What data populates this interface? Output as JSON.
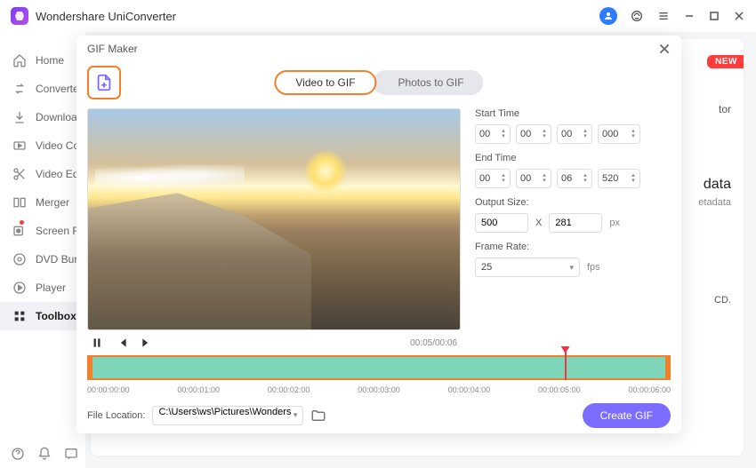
{
  "app": {
    "title": "Wondershare UniConverter"
  },
  "sidebar": {
    "items": [
      {
        "label": "Home"
      },
      {
        "label": "Converter"
      },
      {
        "label": "Downloader"
      },
      {
        "label": "Video Compressor"
      },
      {
        "label": "Video Editor"
      },
      {
        "label": "Merger"
      },
      {
        "label": "Screen Recorder"
      },
      {
        "label": "DVD Burner"
      },
      {
        "label": "Player"
      },
      {
        "label": "Toolbox"
      }
    ]
  },
  "bg": {
    "new_badge": "NEW",
    "text1": "tor",
    "text2": "data",
    "text3": "etadata",
    "text4": "CD."
  },
  "dialog": {
    "title": "GIF Maker",
    "tabs": {
      "video": "Video to GIF",
      "photos": "Photos to GIF"
    },
    "start_label": "Start Time",
    "end_label": "End Time",
    "start": {
      "h": "00",
      "m": "00",
      "s": "00",
      "ms": "000"
    },
    "end": {
      "h": "00",
      "m": "00",
      "s": "06",
      "ms": "520"
    },
    "output_label": "Output Size:",
    "output": {
      "w": "500",
      "h": "281",
      "x": "X",
      "unit": "px"
    },
    "fps_label": "Frame Rate:",
    "fps_value": "25",
    "fps_unit": "fps",
    "video_time": "00:05/00:06",
    "timeline_labels": [
      "00:00:00:00",
      "00:00:01:00",
      "00:00:02:00",
      "00:00:03:00",
      "00:00:04:00",
      "00:00:05:00",
      "00:00:06:00"
    ],
    "file_label": "File Location:",
    "file_path": "C:\\Users\\ws\\Pictures\\Wonders",
    "create_label": "Create GIF"
  }
}
